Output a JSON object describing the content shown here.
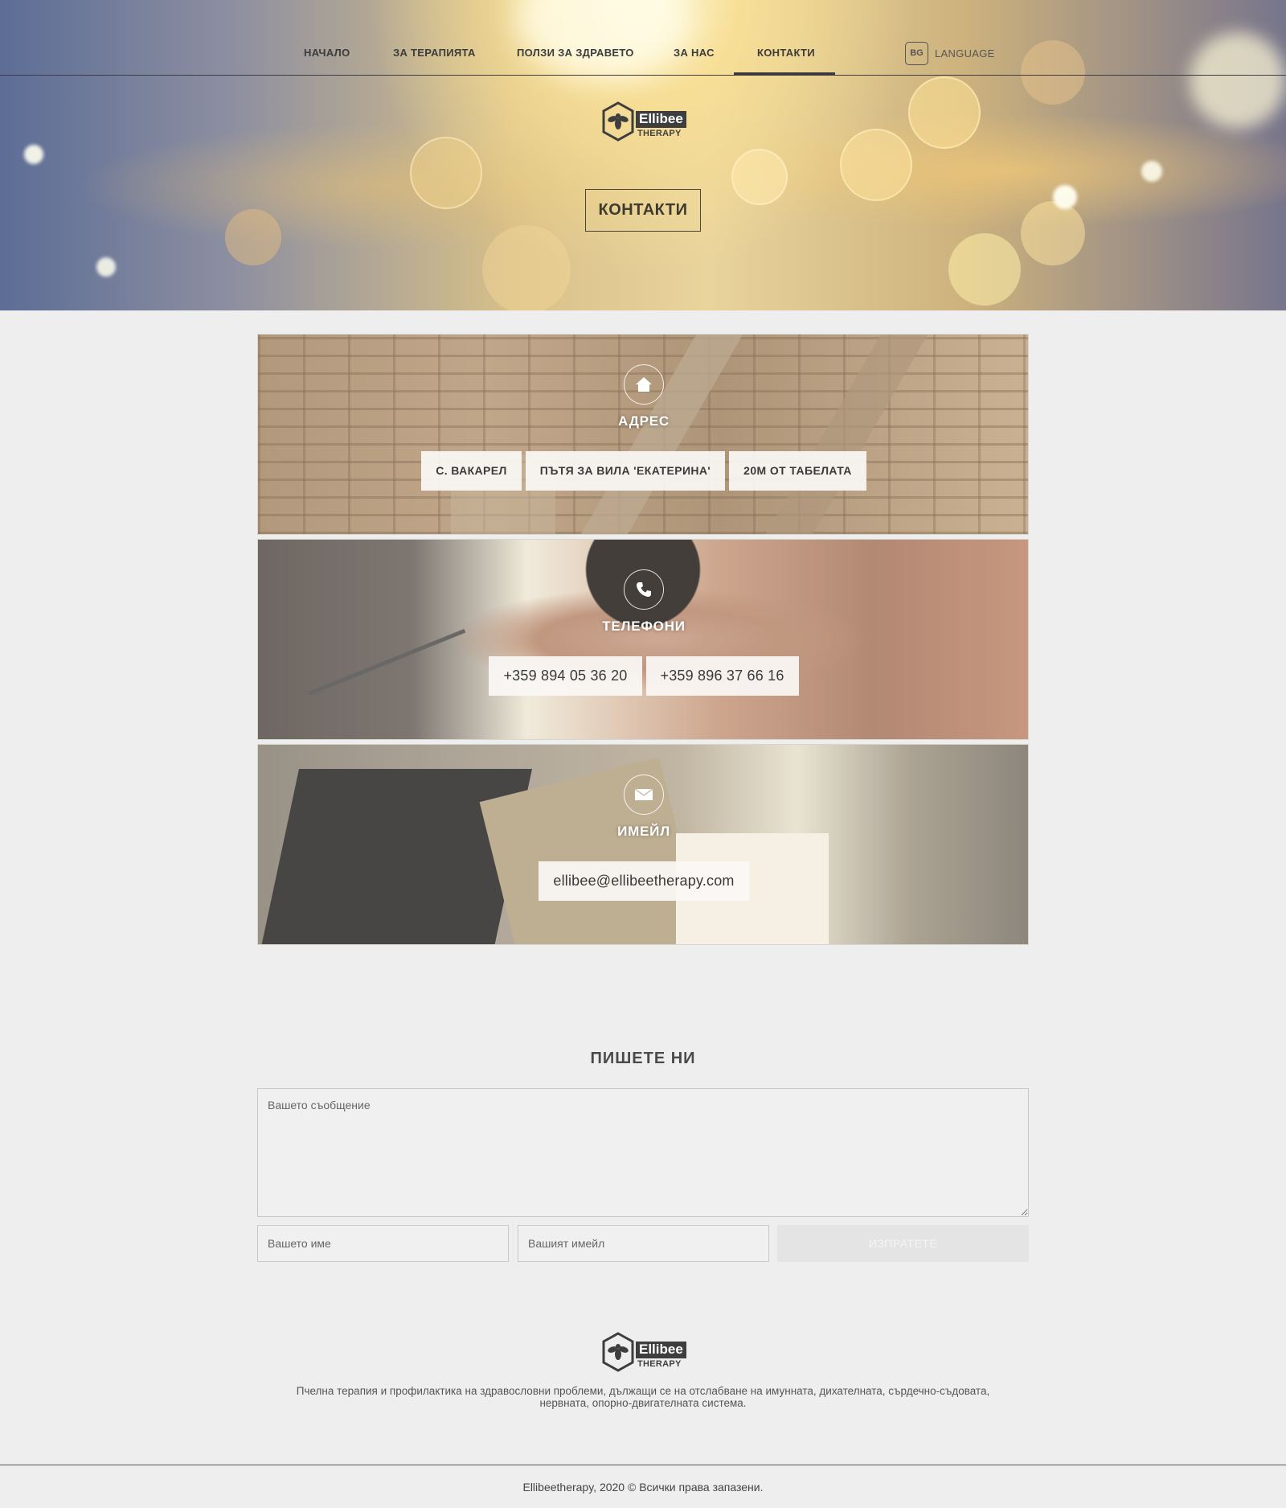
{
  "nav": {
    "items": [
      {
        "label": "НАЧАЛО"
      },
      {
        "label": "ЗА ТЕРАПИЯТА"
      },
      {
        "label": "ПОЛЗИ ЗА ЗДРАВЕТО"
      },
      {
        "label": "ЗА НАС"
      },
      {
        "label": "КОНТАКТИ",
        "active": true
      }
    ],
    "lang_code": "BG",
    "lang_label": "LANGUAGE"
  },
  "logo": {
    "brand": "Ellibee",
    "sub": "THERAPY",
    "icon": "bee-hexagon-icon"
  },
  "hero": {
    "title": "КОНТАКТИ"
  },
  "contacts": {
    "address": {
      "icon": "home-icon",
      "label": "АДРЕС",
      "parts": [
        "С. ВАКАРЕЛ",
        "ПЪТЯ ЗА ВИЛА 'ЕКАТЕРИНА'",
        "20М ОТ ТАБЕЛАТА"
      ]
    },
    "phones": {
      "icon": "phone-icon",
      "label": "ТЕЛЕФОНИ",
      "numbers": [
        "+359 894 05 36 20",
        "+359 896 37 66 16"
      ]
    },
    "email": {
      "icon": "envelope-icon",
      "label": "ИМЕЙЛ",
      "address": "ellibee@ellibeetherapy.com"
    }
  },
  "form": {
    "title": "ПИШЕТЕ НИ",
    "message_placeholder": "Вашето съобщение",
    "name_placeholder": "Вашето име",
    "email_placeholder": "Вашият имейл",
    "submit_label": "ИЗПРАТЕТЕ"
  },
  "footer": {
    "description_line1": "Пчелна терапия и профилактика на здравословни проблеми, дължащи се на отслабване на имунната, дихателната, сърдечно-съдовата,",
    "description_line2": "нервната, опорно-двигателната система.",
    "copyright": "Ellibeetherapy, 2020 © Всички права запазени."
  },
  "colors": {
    "background": "#eeeeee",
    "text": "#444444",
    "accent_dark": "#3e3e3e",
    "button_disabled": "#e4e4e4"
  }
}
